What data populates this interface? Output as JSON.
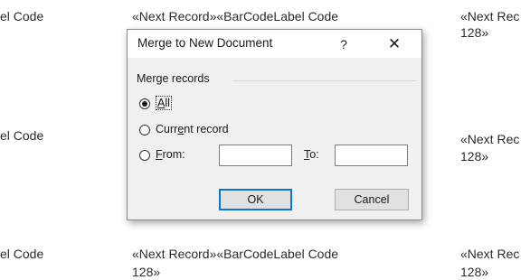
{
  "document": {
    "left_col": [
      "el Code",
      "el Code",
      "el Code"
    ],
    "mid_row1": "«Next Record»«BarCodeLabel Code",
    "mid_row3_line1": "«Next Record»«BarCodeLabel Code",
    "mid_row3_line2": "128»",
    "right_row1_line1": "«Next Rec",
    "right_row1_line2": "128»",
    "right_row2_line1": "«Next Rec",
    "right_row2_line2": "128»",
    "right_row3_line1": "«Next Rec",
    "right_row3_line2": "128»"
  },
  "dialog": {
    "title": "Merge to New Document",
    "help_glyph": "?",
    "close_glyph": "✕",
    "group_label": "Merge records",
    "radio_all": {
      "pre": "",
      "u": "A",
      "post": "ll",
      "checked": true
    },
    "radio_current": {
      "pre": "Curr",
      "u": "e",
      "post": "nt record",
      "checked": false
    },
    "radio_from": {
      "pre": "",
      "u": "F",
      "post": "rom:",
      "checked": false
    },
    "from_value": "",
    "to_label": {
      "u": "T",
      "post": "o:"
    },
    "to_value": "",
    "ok_label": "OK",
    "cancel_label": "Cancel"
  }
}
